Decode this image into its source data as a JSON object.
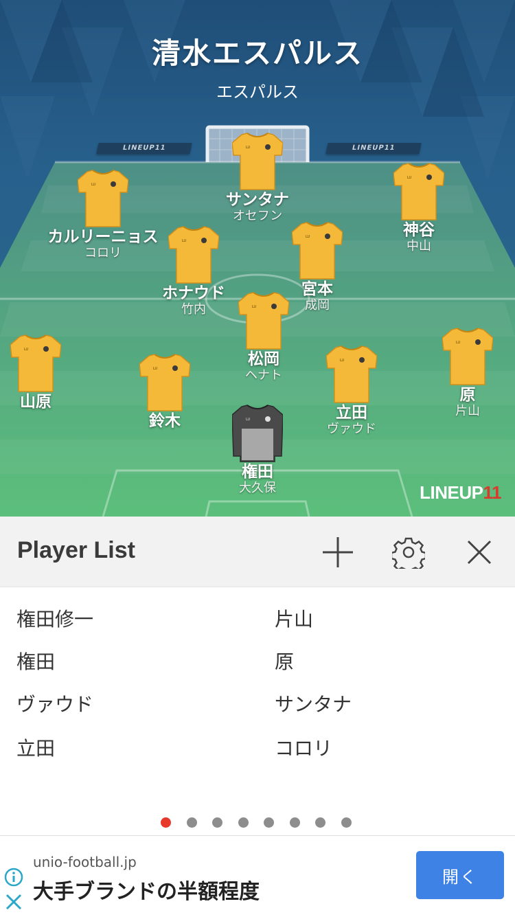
{
  "team": {
    "title": "清水エスパルス",
    "subtitle": "エスパルス"
  },
  "boards": {
    "left": "LINEUP11",
    "right": "LINEUP11"
  },
  "watermark": {
    "text": "LINEUP",
    "num": "11"
  },
  "players": [
    {
      "id": "p1",
      "name": "サンタナ",
      "sub": "オセフン",
      "kit": "yellow"
    },
    {
      "id": "p2",
      "name": "カルリーニョス",
      "sub": "コロリ",
      "kit": "yellow"
    },
    {
      "id": "p3",
      "name": "神谷",
      "sub": "中山",
      "kit": "yellow"
    },
    {
      "id": "p4",
      "name": "ホナウド",
      "sub": "竹内",
      "kit": "yellow"
    },
    {
      "id": "p5",
      "name": "宮本",
      "sub": "成岡",
      "kit": "yellow"
    },
    {
      "id": "p6",
      "name": "松岡",
      "sub": "ヘナト",
      "kit": "yellow"
    },
    {
      "id": "p7",
      "name": "山原",
      "sub": "",
      "kit": "yellow"
    },
    {
      "id": "p8",
      "name": "鈴木",
      "sub": "",
      "kit": "yellow"
    },
    {
      "id": "p9",
      "name": "立田",
      "sub": "ヴァウド",
      "kit": "yellow"
    },
    {
      "id": "p10",
      "name": "原",
      "sub": "片山",
      "kit": "yellow"
    },
    {
      "id": "p11",
      "name": "権田",
      "sub": "大久保",
      "kit": "goalkeeper"
    }
  ],
  "player_list": {
    "title": "Player List",
    "add_icon": "plus-icon",
    "settings_icon": "gear-icon",
    "close_icon": "close-icon",
    "left": [
      "権田修一",
      "権田",
      "ヴァウド",
      "立田"
    ],
    "right": [
      "片山",
      "原",
      "サンタナ",
      "コロリ"
    ]
  },
  "pager": {
    "pages": 8,
    "active": 1
  },
  "ad": {
    "domain": "unio-football.jp",
    "text": "大手ブランドの半額程度",
    "button": "開く",
    "info_icon": "info-icon",
    "close_icon": "close-icon"
  },
  "colors": {
    "kit_yellow": "#f5b93a",
    "kit_gk": "#4a4a4a",
    "pitch_green": "#56b879",
    "accent_blue": "#3e82e5",
    "active_dot": "#e8372b"
  }
}
